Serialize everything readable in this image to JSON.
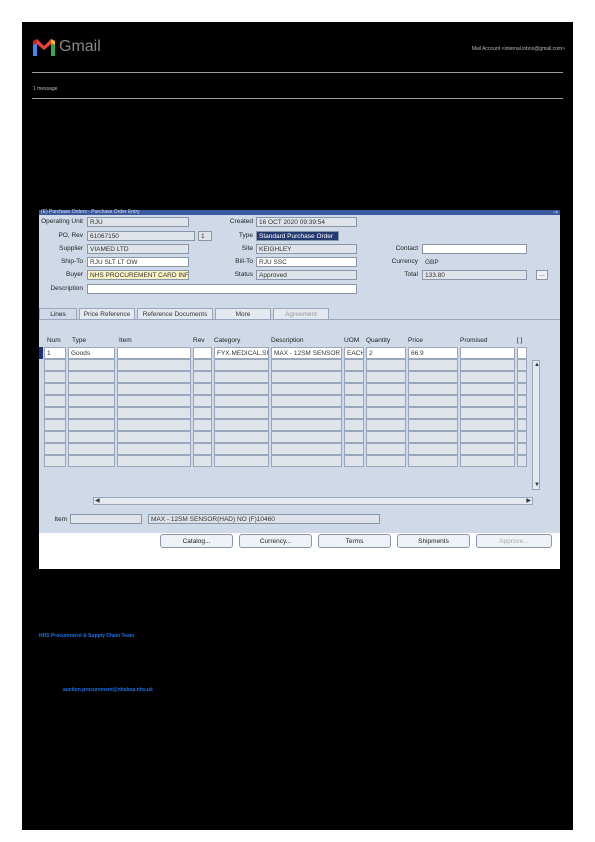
{
  "gmail": {
    "brand": "Gmail",
    "account": "Mail Account <internal.inbox@gmail.com>",
    "message_count": "1 message"
  },
  "app": {
    "title": "(E) Purchase Orders - Purchase Order Entry",
    "labels": {
      "operating_unit": "Operating Unit",
      "po_rev": "PO, Rev",
      "supplier": "Supplier",
      "ship_to": "Ship-To",
      "buyer": "Buyer",
      "description": "Description",
      "created": "Created",
      "type": "Type",
      "site": "Site",
      "bill_to": "Bill-To",
      "status": "Status",
      "contact": "Contact",
      "currency": "Currency",
      "total": "Total"
    },
    "values": {
      "operating_unit": "RJU",
      "po_number": "61067150",
      "revision": "1",
      "supplier": "VIAMED LTD",
      "ship_to": "RJU SLT LT OW",
      "buyer": "NHS PROCUREMENT CARD INFO",
      "description": "",
      "created": "16 OCT 2020 09:39:54",
      "type": "Standard Purchase Order",
      "site": "KEIGHLEY",
      "bill_to": "RJU SSC",
      "status": "Approved",
      "contact": "",
      "currency": "GBP",
      "total": "133.80"
    },
    "tabs": [
      "Lines",
      "Price Reference",
      "Reference Documents",
      "More",
      "Agreement"
    ],
    "grid": {
      "headers": [
        "Num",
        "Type",
        "Item",
        "Rev",
        "Category",
        "Description",
        "UOM",
        "Quantity",
        "Price",
        "Promised",
        "[ ]"
      ],
      "rows": [
        [
          "1",
          "Goods",
          "",
          "",
          "FYX.MEDICAL.SU",
          "MAX - 12SM SENSOR",
          "EACH",
          "2",
          "66.9",
          "",
          ""
        ]
      ]
    },
    "item_label": "Item",
    "item_description": "MAX - 12SM SENSOR(HAD) NO (F)10460",
    "buttons": [
      "Catalog...",
      "Currency...",
      "Terms",
      "Shipments",
      "Approve..."
    ]
  },
  "footer": {
    "team": "NHS Procurement & Supply Chain Team",
    "email": "auction.procurement@nhsbsp.nhs.uk"
  }
}
